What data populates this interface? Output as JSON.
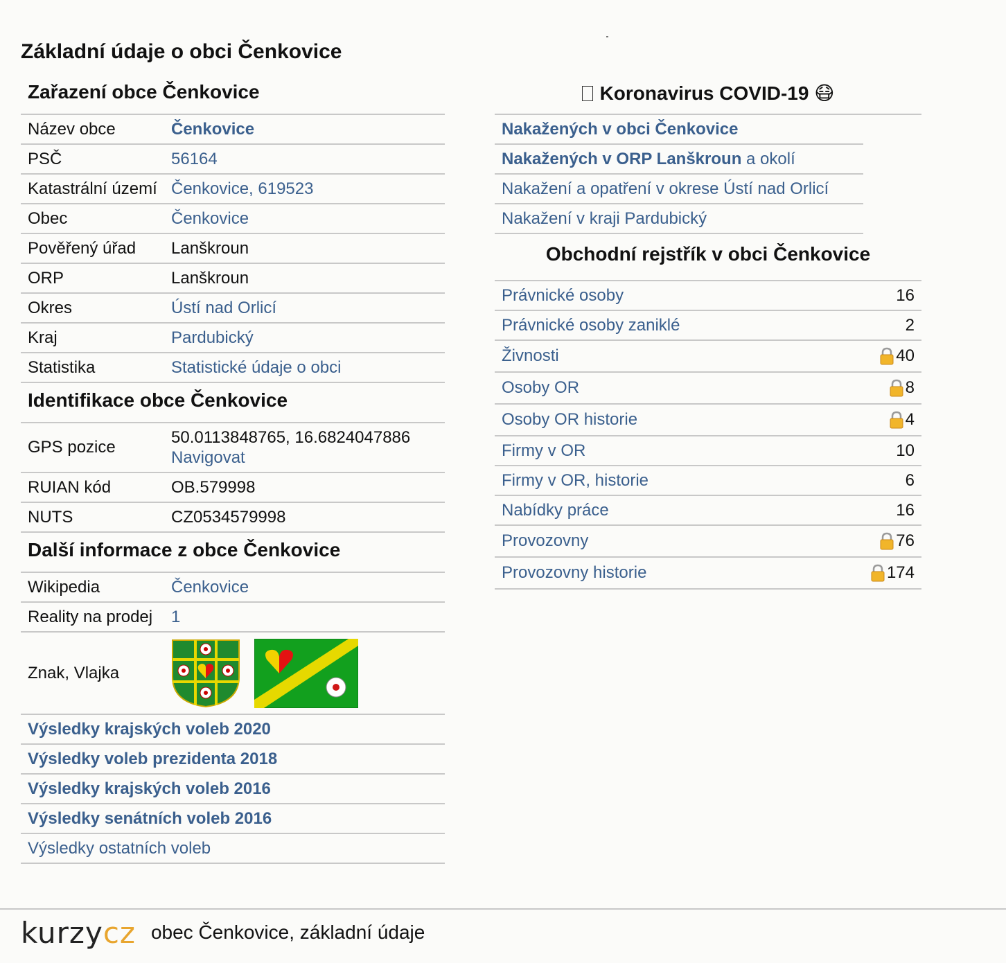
{
  "title": "Základní údaje o obci Čenkovice",
  "zarazeni": {
    "heading": "Zařazení obce Čenkovice",
    "rows": [
      {
        "k": "Název obce",
        "v": "Čenkovice"
      },
      {
        "k": "PSČ",
        "v": "56164"
      },
      {
        "k": "Katastrální území",
        "v": "Čenkovice, 619523"
      },
      {
        "k": "Obec",
        "v": "Čenkovice"
      },
      {
        "k": "Pověřený úřad",
        "v": "Lanškroun"
      },
      {
        "k": "ORP",
        "v": "Lanškroun"
      },
      {
        "k": "Okres",
        "v": "Ústí nad Orlicí"
      },
      {
        "k": "Kraj",
        "v": "Pardubický"
      },
      {
        "k": "Statistika",
        "v": "Statistické údaje o obci"
      }
    ]
  },
  "identifikace": {
    "heading": "Identifikace obce Čenkovice",
    "gps_label": "GPS pozice",
    "gps_value": "50.0113848765, 16.6824047886",
    "gps_nav": "Navigovat",
    "ruian_label": "RUIAN kód",
    "ruian_value": "OB.579998",
    "nuts_label": "NUTS",
    "nuts_value": "CZ0534579998"
  },
  "dalsi": {
    "heading": "Další informace z obce Čenkovice",
    "wiki_label": "Wikipedia",
    "wiki_value": "Čenkovice",
    "reality_label": "Reality na prodej",
    "reality_value": "1",
    "znak_label": "Znak, Vlajka"
  },
  "volby": [
    "Výsledky krajských voleb 2020",
    "Výsledky voleb prezidenta 2018",
    "Výsledky krajských voleb 2016",
    "Výsledky senátních voleb 2016",
    "Výsledky ostatních voleb"
  ],
  "covid": {
    "heading": "Koronavirus COVID-19",
    "emoji": "😷",
    "row1": "Nakažených v obci Čenkovice",
    "row2_bold": "Nakažených v ORP Lanškroun",
    "row2_rest": " a okolí",
    "row3": "Nakažení a opatření v okrese Ústí nad Orlicí",
    "row4": "Nakažení v kraji Pardubický"
  },
  "rejstrik": {
    "heading": "Obchodní rejstřík v obci Čenkovice",
    "rows": [
      {
        "label": "Právnické osoby",
        "value": "16"
      },
      {
        "label": "Právnické osoby zaniklé",
        "value": "2"
      },
      {
        "label": "Živnosti",
        "value": "40"
      },
      {
        "label": "Osoby OR",
        "value": "8"
      },
      {
        "label": "Osoby OR historie",
        "value": "4"
      },
      {
        "label": "Firmy v OR",
        "value": "10"
      },
      {
        "label": "Firmy v OR, historie",
        "value": "6"
      },
      {
        "label": "Nabídky práce",
        "value": "16"
      },
      {
        "label": "Provozovny",
        "value": "76"
      },
      {
        "label": "Provozovny historie",
        "value": "174"
      }
    ]
  },
  "footer": {
    "logo_a": "kurzy",
    "logo_b": "cz",
    "text": "obec Čenkovice, základní údaje"
  },
  "colors": {
    "link": "#3a5f8d",
    "logo_accent": "#e8a52e",
    "flag_green": "#0e9a2a",
    "flag_yellow": "#e6d900"
  },
  "icons": [
    "lock-icon",
    "mask-emoji-icon",
    "coat-of-arms",
    "flag"
  ]
}
